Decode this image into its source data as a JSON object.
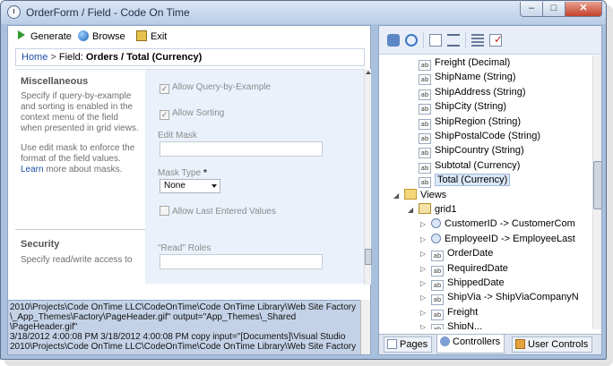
{
  "window": {
    "title": "OrderForm / Field - Code On Time",
    "buttons": {
      "minimize": "–",
      "maximize": "□",
      "close": "✕"
    }
  },
  "toolbar": {
    "generate": "Generate",
    "browse": "Browse",
    "exit": "Exit"
  },
  "breadcrumb": {
    "home": "Home",
    "separator": " > ",
    "field_prefix": "Field: ",
    "current": "Orders / Total (Currency)"
  },
  "misc": {
    "title": "Miscellaneous",
    "desc1": "Specify if query-by-example and sorting is enabled in the context menu of the field when presented in grid views.",
    "desc2_a": "Use edit mask to enforce the format of the field values.",
    "desc2_link": "Learn",
    "desc2_b": " more about masks.",
    "allow_qbe": "Allow Query-by-Example",
    "allow_sorting": "Allow Sorting",
    "edit_mask_label": "Edit Mask",
    "mask_type_label": "Mask Type",
    "mask_type_required": "*",
    "mask_type_value": "None",
    "allow_last": "Allow Last Entered Values"
  },
  "security": {
    "title": "Security",
    "desc": "Specify read/write access to",
    "read_roles_label": "\"Read\" Roles"
  },
  "log": {
    "lines": [
      "2010\\Projects\\Code OnTime LLC\\CodeOnTime\\Code OnTime Library\\Web Site Factory",
      "\\_App_Themes\\Factory\\PageHeader.gif\" output=\"App_Themes\\_Shared",
      "\\PageHeader.gif\"",
      "3/18/2012 4:00:08 PM 3/18/2012 4:00:08 PM copy input=\"[Documents]\\Visual Studio",
      "2010\\Projects\\Code OnTime LLC\\CodeOnTime\\Code OnTime Library\\Web Site Factory"
    ]
  },
  "tree": {
    "nodes": [
      {
        "label": "Freight (Decimal)",
        "icon": "field-icon",
        "indent": 1,
        "expander": ""
      },
      {
        "label": "ShipName (String)",
        "icon": "field-icon",
        "indent": 1,
        "expander": ""
      },
      {
        "label": "ShipAddress (String)",
        "icon": "field-icon",
        "indent": 1,
        "expander": ""
      },
      {
        "label": "ShipCity (String)",
        "icon": "field-icon",
        "indent": 1,
        "expander": ""
      },
      {
        "label": "ShipRegion (String)",
        "icon": "field-icon",
        "indent": 1,
        "expander": ""
      },
      {
        "label": "ShipPostalCode (String)",
        "icon": "field-icon",
        "indent": 1,
        "expander": ""
      },
      {
        "label": "ShipCountry (String)",
        "icon": "field-icon",
        "indent": 1,
        "expander": ""
      },
      {
        "label": "Subtotal (Currency)",
        "icon": "field-icon",
        "indent": 1,
        "expander": ""
      },
      {
        "label": "Total (Currency)",
        "icon": "field-icon",
        "indent": 1,
        "expander": "",
        "selected": true
      },
      {
        "label": "Views",
        "icon": "folder-icon",
        "indent": 0,
        "expander": "◢"
      },
      {
        "label": "grid1",
        "icon": "grid-icon",
        "indent": 1,
        "expander": "◢"
      },
      {
        "label": "CustomerID -> CustomerCom",
        "icon": "lookup-icon",
        "indent": 2,
        "expander": "▷"
      },
      {
        "label": "EmployeeID -> EmployeeLast",
        "icon": "lookup-icon",
        "indent": 2,
        "expander": "▷"
      },
      {
        "label": "OrderDate",
        "icon": "field-icon",
        "indent": 2,
        "expander": "▷"
      },
      {
        "label": "RequiredDate",
        "icon": "field-icon",
        "indent": 2,
        "expander": "▷"
      },
      {
        "label": "ShippedDate",
        "icon": "field-icon",
        "indent": 2,
        "expander": "▷"
      },
      {
        "label": "ShipVia -> ShipViaCompanyN",
        "icon": "field-icon",
        "indent": 2,
        "expander": "▷"
      },
      {
        "label": "Freight",
        "icon": "field-icon",
        "indent": 2,
        "expander": "▷"
      },
      {
        "label": "ShipN...",
        "icon": "field-icon",
        "indent": 2,
        "expander": "▷"
      }
    ]
  },
  "tabs": [
    {
      "label": "Pages"
    },
    {
      "label": "Controllers",
      "active": true
    },
    {
      "label": "User Controls"
    }
  ]
}
